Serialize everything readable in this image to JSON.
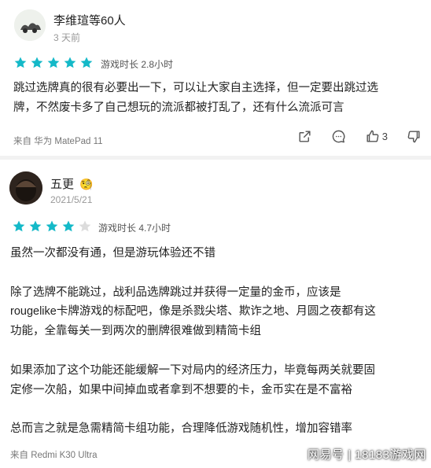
{
  "reviews": [
    {
      "username": "李维瑄等60人",
      "date": "3 天前",
      "rating": 5,
      "playtime_label": "游戏时长 2.8小时",
      "content": [
        "跳过选牌真的很有必要出一下，可以让大家自主选择，但一定要出跳过选",
        "牌，不然废卡多了自己想玩的流派都被打乱了，还有什么流派可言"
      ],
      "device": "来自 华为 MatePad 11",
      "like_count": "3"
    },
    {
      "username": "五更",
      "date": "2021/5/21",
      "rating": 4,
      "playtime_label": "游戏时长 4.7小时",
      "content": [
        "虽然一次都没有通，但是游玩体验还不错",
        "",
        "除了选牌不能跳过，战利品选牌跳过并获得一定量的金币，应该是",
        "rougelike卡牌游戏的标配吧，像是杀戮尖塔、欺诈之地、月圆之夜都有这",
        "功能，全靠每关一到两次的删牌很难做到精简卡组",
        "",
        "如果添加了这个功能还能缓解一下对局内的经济压力，毕竟每两关就要固",
        "定修一次船，如果中间掉血或者拿到不想要的卡，金币实在是不富裕",
        "",
        "总而言之就是急需精简卡组功能，合理降低游戏随机性，增加容错率"
      ],
      "device": "来自 Redmi K30 Ultra"
    }
  ],
  "watermark": "网易号 | 18183游戏网",
  "colors": {
    "star_on": "#14b9c8",
    "star_off": "#dcdcdc"
  }
}
